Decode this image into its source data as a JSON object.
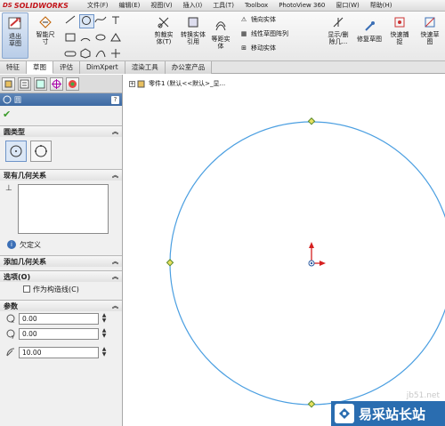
{
  "app": {
    "logo_text": "SOLIDWORKS",
    "logo_prefix": "DS"
  },
  "menu": [
    "文件(F)",
    "编辑(E)",
    "视图(V)",
    "插入(I)",
    "工具(T)",
    "Toolbox",
    "PhotoView 360",
    "窗口(W)",
    "帮助(H)"
  ],
  "ribbon": {
    "exit_sketch": "退出草图",
    "smart_dim": "智能尺寸",
    "trim": "剪裁实体(T)",
    "convert": "转换实体引用",
    "offset": "等距实体",
    "mirror": "镜向实体",
    "linear_pattern": "线性草图阵列",
    "move": "移动实体",
    "show_hide": "显示/删除几...",
    "repair": "修复草图",
    "quick_snap": "快速捕捉",
    "quick_sketch": "快速草图"
  },
  "tabs": [
    "特征",
    "草图",
    "评估",
    "DimXpert",
    "渲染工具",
    "办公室产品"
  ],
  "active_tab": "草图",
  "panel": {
    "title": "圆",
    "help": "?",
    "ok_icon": "check-icon",
    "circle_type": "圆类型",
    "existing_relations": "现有几何关系",
    "status": "欠定义",
    "add_relations": "添加几何关系",
    "options": "选项(O)",
    "construction_label": "作为构造线(C)",
    "params": "参数",
    "x_value": "0.00",
    "y_value": "0.00",
    "radius_value": "10.00"
  },
  "tree": {
    "part": "零件1 (默认<<默认>_显..."
  },
  "watermark": {
    "text": "易采站长站",
    "url": "jb51.net"
  },
  "colors": {
    "circle": "#4b9fe1",
    "origin": "#d62020",
    "title_bar": "#3d6aa3"
  }
}
